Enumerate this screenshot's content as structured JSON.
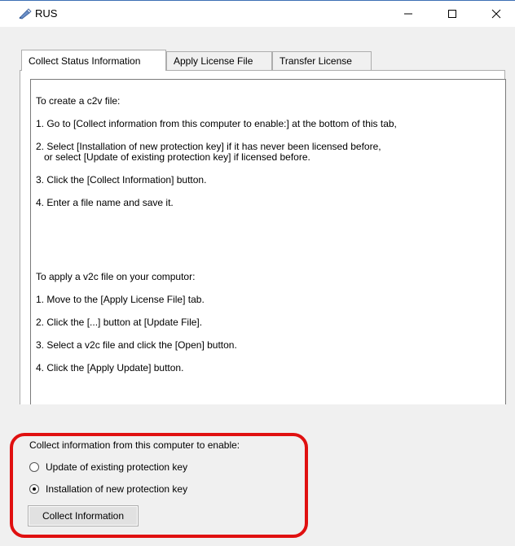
{
  "window": {
    "title": "RUS",
    "icon": "key-pen-icon",
    "controls": [
      "minimize",
      "maximize",
      "close"
    ]
  },
  "tabs": [
    {
      "label": "Collect Status Information",
      "active": true
    },
    {
      "label": "Apply License File",
      "active": false
    },
    {
      "label": "Transfer License",
      "active": false
    }
  ],
  "instructions": {
    "lines": [
      "To create a c2v file:",
      "1. Go to [Collect information from this computer to enable:] at the bottom of this tab,",
      "2. Select [Installation of new protection key] if it has never been licensed before,",
      "   or select [Update of existing protection key] if licensed before.",
      "3. Click the [Collect Information] button.",
      "4. Enter a file name and save it.",
      "To apply a v2c file on your computor:",
      "1. Move to the [Apply License File] tab.",
      "2. Click the [...] button at [Update File].",
      "3. Select a v2c file and click the [Open] button.",
      "4. Click the [Apply Update] button."
    ]
  },
  "collect": {
    "label": "Collect information from this computer to enable:",
    "options": [
      {
        "label": "Update of existing protection key",
        "selected": false
      },
      {
        "label": "Installation of new protection key",
        "selected": true
      }
    ],
    "button_label": "Collect Information"
  },
  "colors": {
    "highlight": "#e01010",
    "window_bg": "#f0f0f0",
    "title_accent": "#3c6fb4"
  }
}
